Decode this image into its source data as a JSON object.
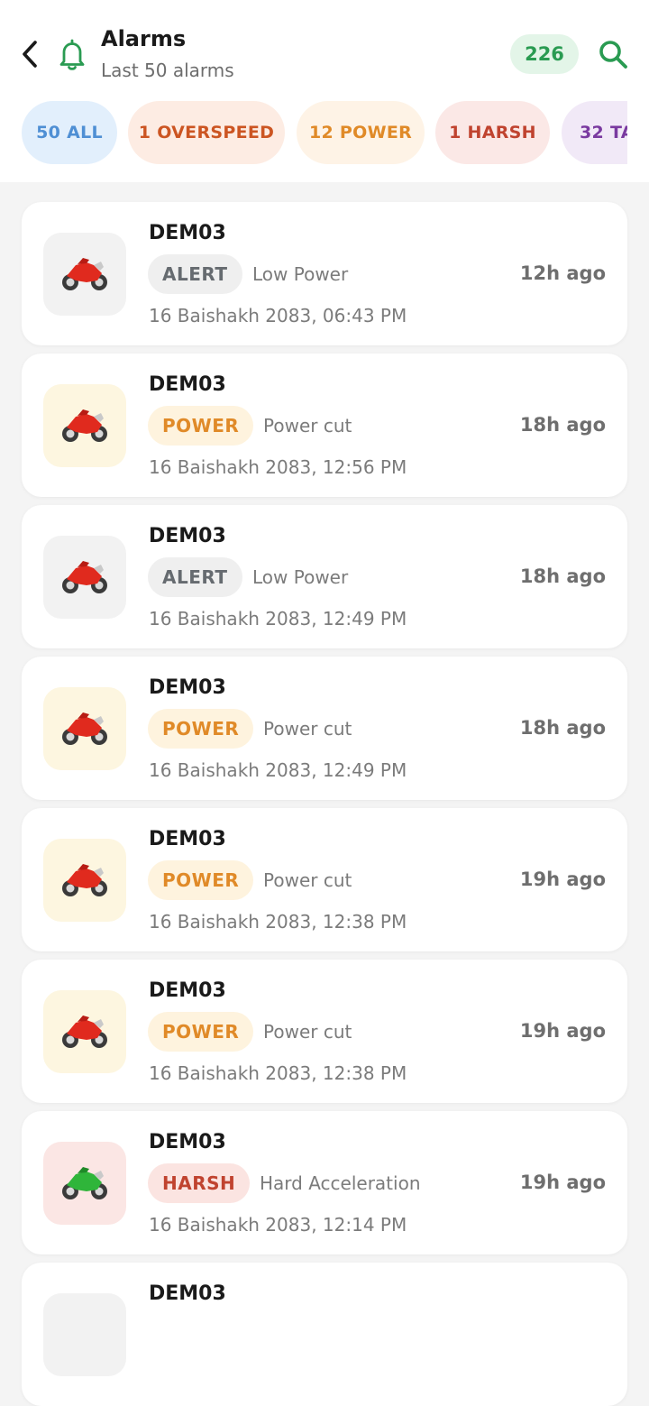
{
  "header": {
    "title": "Alarms",
    "subtitle": "Last 50 alarms",
    "count": "226"
  },
  "icons": {
    "back": "chevron-left-icon",
    "bell": "bell-icon",
    "search": "search-icon",
    "vehicle": "motorcycle-icon"
  },
  "colors": {
    "accent_green": "#2a9b52",
    "all": "#4f8fd4",
    "overspeed": "#cc5522",
    "power": "#e08a28",
    "harsh": "#c0432f",
    "tamper": "#7a3aa0"
  },
  "filters": [
    {
      "label": "50 ALL"
    },
    {
      "label": "1 OVERSPEED"
    },
    {
      "label": "12 POWER"
    },
    {
      "label": "1 HARSH"
    },
    {
      "label": "32 TA"
    }
  ],
  "alarms": [
    {
      "vehicle": "DEM03",
      "tag": "ALERT",
      "description": "Low Power",
      "date": "16 Baishakh 2083, 06:43 PM",
      "ago": "12h ago",
      "bike_color": "red"
    },
    {
      "vehicle": "DEM03",
      "tag": "POWER",
      "description": "Power cut",
      "date": "16 Baishakh 2083, 12:56 PM",
      "ago": "18h ago",
      "bike_color": "red"
    },
    {
      "vehicle": "DEM03",
      "tag": "ALERT",
      "description": "Low Power",
      "date": "16 Baishakh 2083, 12:49 PM",
      "ago": "18h ago",
      "bike_color": "red"
    },
    {
      "vehicle": "DEM03",
      "tag": "POWER",
      "description": "Power cut",
      "date": "16 Baishakh 2083, 12:49 PM",
      "ago": "18h ago",
      "bike_color": "red"
    },
    {
      "vehicle": "DEM03",
      "tag": "POWER",
      "description": "Power cut",
      "date": "16 Baishakh 2083, 12:38 PM",
      "ago": "19h ago",
      "bike_color": "red"
    },
    {
      "vehicle": "DEM03",
      "tag": "POWER",
      "description": "Power cut",
      "date": "16 Baishakh 2083, 12:38 PM",
      "ago": "19h ago",
      "bike_color": "red"
    },
    {
      "vehicle": "DEM03",
      "tag": "HARSH",
      "description": "Hard Acceleration",
      "date": "16 Baishakh 2083, 12:14 PM",
      "ago": "19h ago",
      "bike_color": "green"
    },
    {
      "vehicle": "DEM03"
    }
  ]
}
